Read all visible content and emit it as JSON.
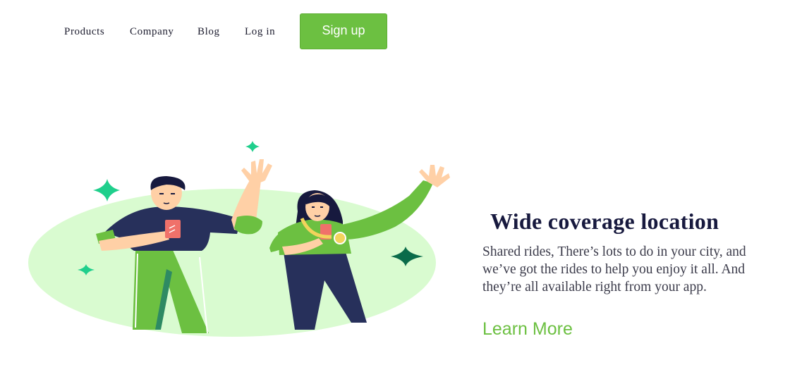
{
  "nav": {
    "links": [
      "Products",
      "Company",
      "Blog",
      "Log in"
    ],
    "signup_label": "Sign up"
  },
  "feature": {
    "title": "Wide coverage location",
    "description": "Shared rides, There’s lots to do in your city, and we’ve got the rides to help you enjoy it all. And they’re all available right from your app.",
    "cta_label": "Learn More"
  },
  "colors": {
    "accent_green": "#6cc041",
    "title_navy": "#17193e",
    "blob_green": "#d9fbd0",
    "sparkle_green": "#1fcf8c"
  }
}
